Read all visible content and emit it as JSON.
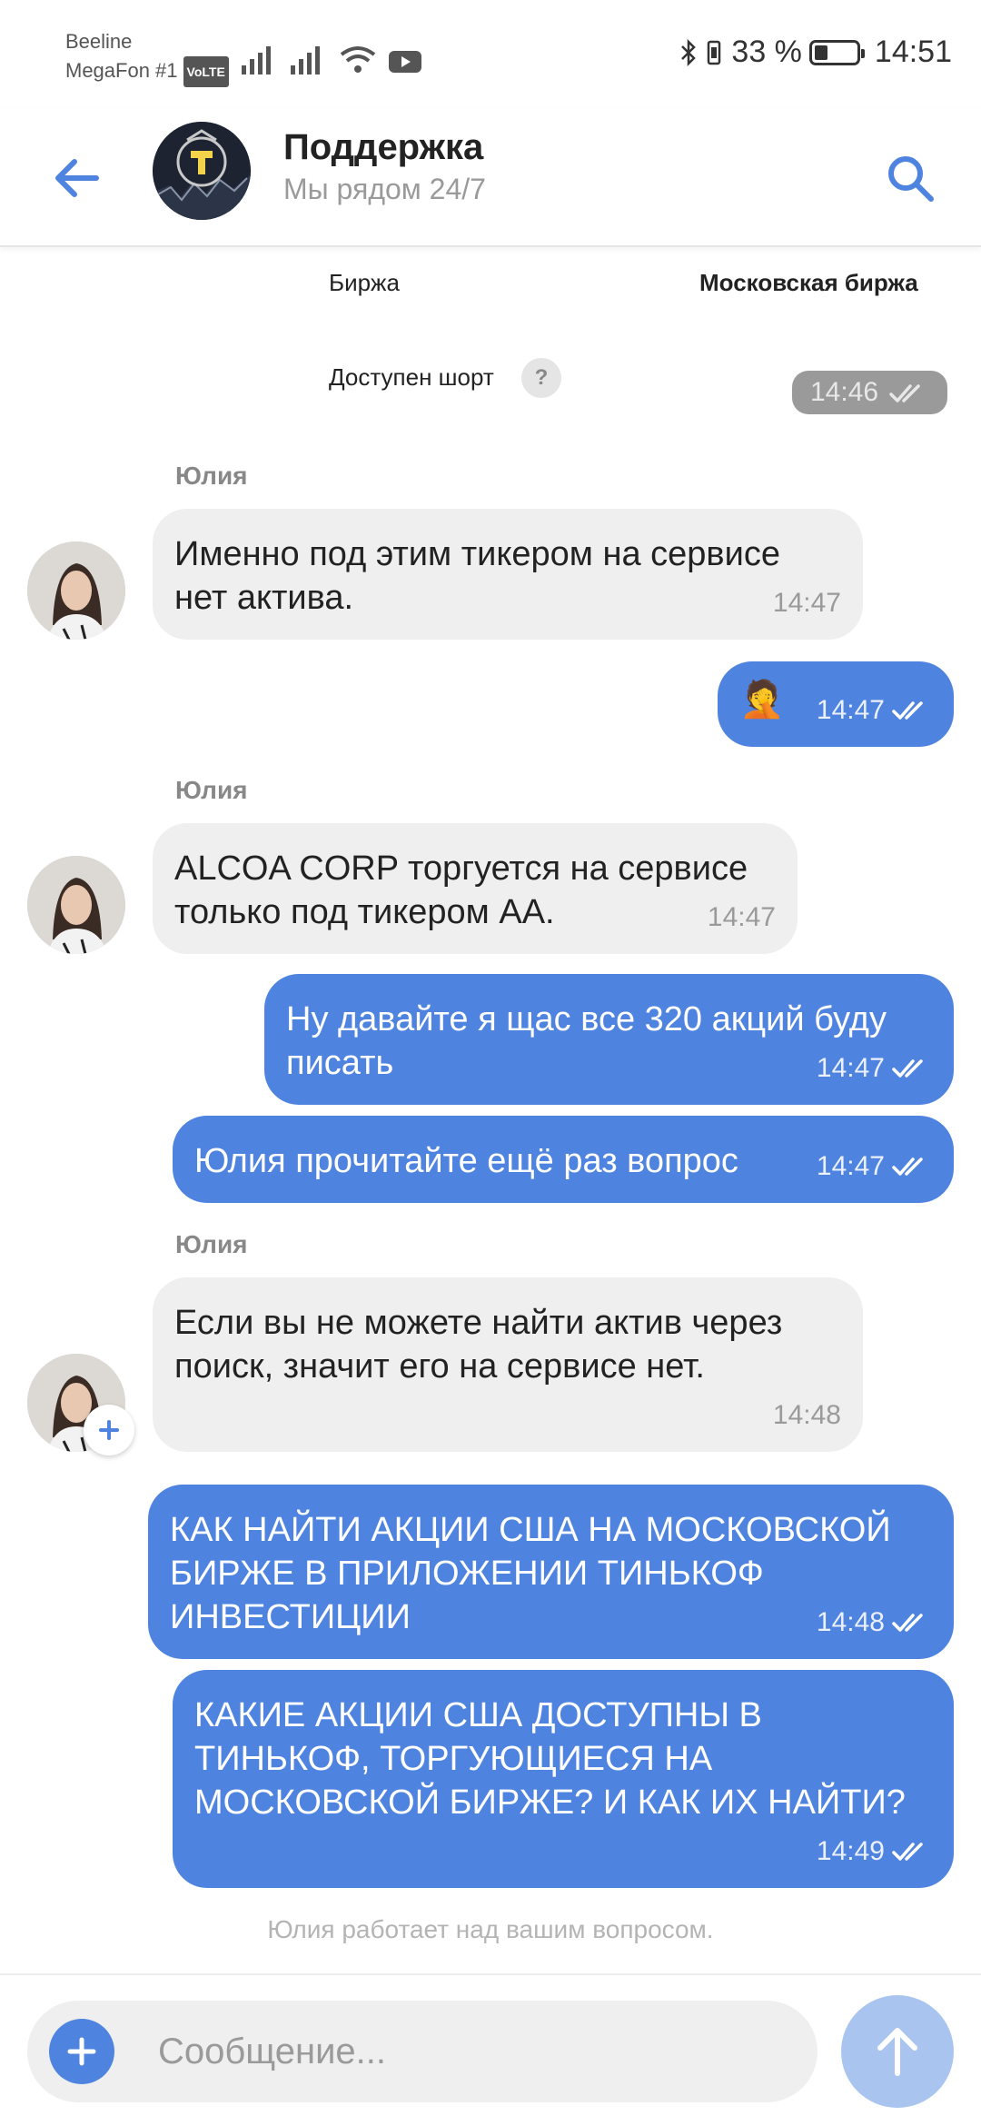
{
  "status_bar": {
    "carrier_1": "Beeline",
    "carrier_2": "MegaFon #1",
    "volte": "VoLTE",
    "battery": "33 %",
    "battery_level": 0.33,
    "time": "14:51"
  },
  "header": {
    "title": "Поддержка",
    "subtitle": "Мы рядом 24/7",
    "icons": [
      "back-arrow-icon",
      "support-logo",
      "search-icon"
    ]
  },
  "chat": {
    "partial_table": {
      "row1_label": "Биржа",
      "row1_value": "Московская биржа",
      "row2_label": "Доступен шорт",
      "row2_badge": "?",
      "row2_time": "14:46"
    },
    "groups": [
      {
        "sender": "Юлия",
        "messages": [
          {
            "text": "Именно под этим тикером на сервисе нет актива.",
            "time": "14:47"
          }
        ]
      },
      {
        "outgoing": [
          {
            "text": "🤦",
            "time": "14:47"
          }
        ]
      },
      {
        "sender": "Юлия",
        "messages": [
          {
            "text": "ALCOA CORP торгуется на сервисе только под тикером AA.",
            "time": "14:47"
          }
        ]
      },
      {
        "outgoing": [
          {
            "text": "Ну давайте я щас все 320 акций буду писать",
            "time": "14:47"
          },
          {
            "text": "Юлия прочитайте ещё раз вопрос",
            "time": "14:47"
          }
        ]
      },
      {
        "sender": "Юлия",
        "messages": [
          {
            "text": "Если вы не можете найти актив через поиск, значит его на сервисе нет.",
            "time": "14:48"
          }
        ]
      },
      {
        "outgoing": [
          {
            "text": "КАК НАЙТИ АКЦИИ США НА МОСКОВСКОЙ БИРЖЕ В ПРИЛОЖЕНИИ ТИНЬКОФ ИНВЕСТИЦИИ",
            "time": "14:48"
          },
          {
            "text": "КАКИЕ АКЦИИ США ДОСТУПНЫ В ТИНЬКОФ, ТОРГУЮЩИЕСЯ НА МОСКОВСКОЙ БИРЖЕ? И КАК ИХ НАЙТИ?",
            "time": "14:49"
          }
        ]
      }
    ],
    "typing_status": "Юлия работает над вашим вопросом."
  },
  "composer": {
    "placeholder": "Сообщение..."
  },
  "colors": {
    "accent": "#4f83e0",
    "incoming_bubble": "#efefef",
    "send_button_disabled": "#a9c5ef"
  }
}
